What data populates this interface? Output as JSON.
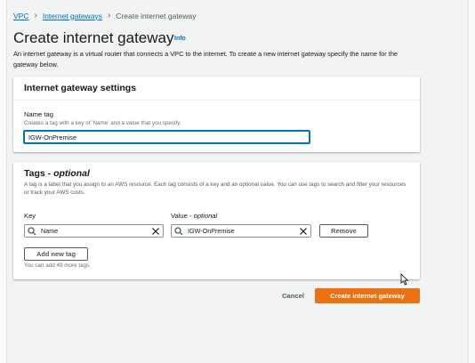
{
  "breadcrumb": {
    "items": [
      "VPC",
      "Internet gateways"
    ],
    "current": "Create internet gateway"
  },
  "page": {
    "title": "Create internet gateway",
    "info_label": "Info",
    "description": "An internet gateway is a virtual router that connects a VPC to the internet. To create a new internet gateway specify the name for the gateway below."
  },
  "settings": {
    "title": "Internet gateway settings",
    "name_label": "Name tag",
    "name_hint": "Creates a tag with a key of 'Name' and a value that you specify.",
    "name_value": "IGW-OnPremise"
  },
  "tags": {
    "title": "Tags - ",
    "title_optional": "optional",
    "description": "A tag is a label that you assign to an AWS resource. Each tag consists of a key and an optional value. You can use tags to search and filter your resources or track your AWS costs.",
    "key_label": "Key",
    "value_label": "Value - ",
    "value_optional": "optional",
    "rows": [
      {
        "key": "Name",
        "value": "IGW-OnPremise"
      }
    ],
    "remove_label": "Remove",
    "add_label": "Add new tag",
    "limit_note": "You can add 49 more tags."
  },
  "actions": {
    "cancel_label": "Cancel",
    "create_label": "Create internet gateway"
  },
  "colors": {
    "link": "#0073bb",
    "primary": "#ec7211",
    "background": "#f2f3f3"
  }
}
